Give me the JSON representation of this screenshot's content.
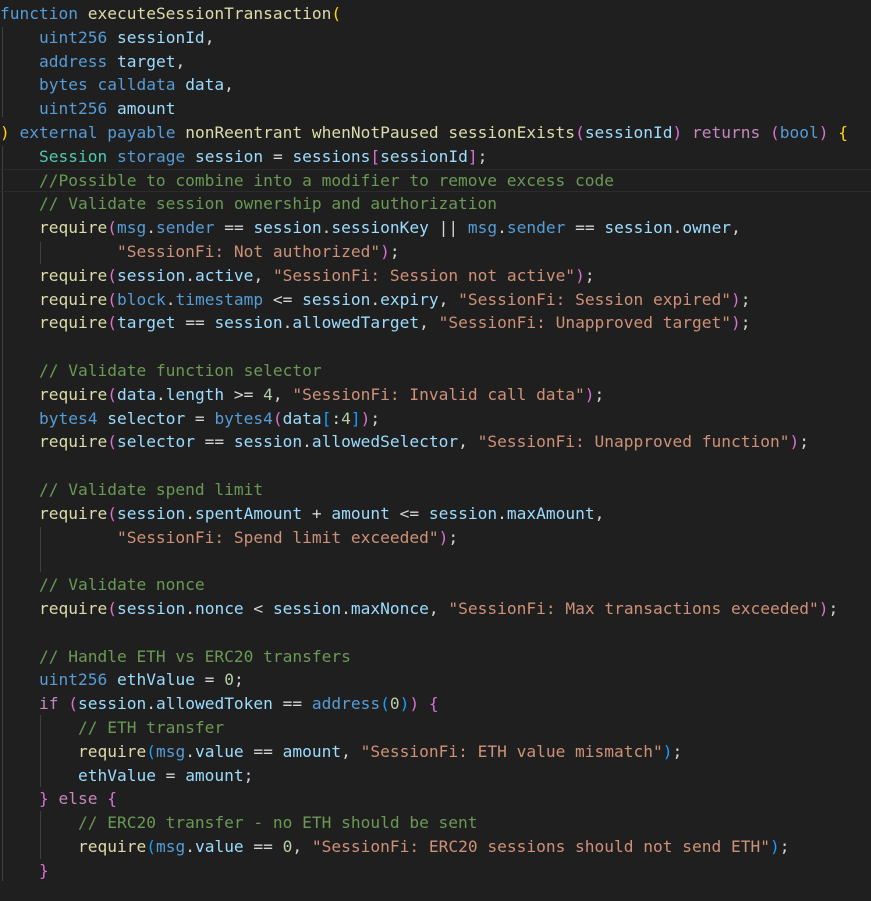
{
  "editor": {
    "language": "solidity",
    "lines": [
      [
        [
          "function",
          "kw"
        ],
        [
          " ",
          ""
        ],
        [
          "executeSessionTransaction",
          "fn"
        ],
        [
          "(",
          "p1"
        ]
      ],
      [
        [
          "    ",
          ""
        ],
        [
          "uint256",
          "kw"
        ],
        [
          " ",
          ""
        ],
        [
          "sessionId",
          "var"
        ],
        [
          ",",
          "op"
        ]
      ],
      [
        [
          "    ",
          ""
        ],
        [
          "address",
          "kw"
        ],
        [
          " ",
          ""
        ],
        [
          "target",
          "var"
        ],
        [
          ",",
          "op"
        ]
      ],
      [
        [
          "    ",
          ""
        ],
        [
          "bytes",
          "kw"
        ],
        [
          " ",
          ""
        ],
        [
          "calldata",
          "kw"
        ],
        [
          " ",
          ""
        ],
        [
          "data",
          "var"
        ],
        [
          ",",
          "op"
        ]
      ],
      [
        [
          "    ",
          ""
        ],
        [
          "uint256",
          "kw"
        ],
        [
          " ",
          ""
        ],
        [
          "amount",
          "var"
        ]
      ],
      [
        [
          ")",
          "p1"
        ],
        [
          " ",
          ""
        ],
        [
          "external",
          "kw"
        ],
        [
          " ",
          ""
        ],
        [
          "payable",
          "kw"
        ],
        [
          " ",
          ""
        ],
        [
          "nonReentrant",
          "fn"
        ],
        [
          " ",
          ""
        ],
        [
          "whenNotPaused",
          "fn"
        ],
        [
          " ",
          ""
        ],
        [
          "sessionExists",
          "fn"
        ],
        [
          "(",
          "p2"
        ],
        [
          "sessionId",
          "var"
        ],
        [
          ")",
          "p2"
        ],
        [
          " ",
          ""
        ],
        [
          "returns",
          "ctl"
        ],
        [
          " ",
          ""
        ],
        [
          "(",
          "p2"
        ],
        [
          "bool",
          "kw"
        ],
        [
          ")",
          "p2"
        ],
        [
          " ",
          ""
        ],
        [
          "{",
          "p1"
        ]
      ],
      [
        [
          "    ",
          ""
        ],
        [
          "Session",
          "ty"
        ],
        [
          " ",
          ""
        ],
        [
          "storage",
          "kw"
        ],
        [
          " ",
          ""
        ],
        [
          "session",
          "var"
        ],
        [
          " ",
          ""
        ],
        [
          "=",
          "op"
        ],
        [
          " ",
          ""
        ],
        [
          "sessions",
          "var"
        ],
        [
          "[",
          "p2"
        ],
        [
          "sessionId",
          "var"
        ],
        [
          "]",
          "p2"
        ],
        [
          ";",
          "op"
        ]
      ],
      [
        [
          "    ",
          ""
        ],
        [
          "//Possible to combine into a modifier to remove excess code",
          "cmt"
        ]
      ],
      [
        [
          "    ",
          ""
        ],
        [
          "// Validate session ownership and authorization",
          "cmt"
        ]
      ],
      [
        [
          "    ",
          ""
        ],
        [
          "require",
          "fn"
        ],
        [
          "(",
          "p2"
        ],
        [
          "msg",
          "kw"
        ],
        [
          ".",
          "op"
        ],
        [
          "sender",
          "kw"
        ],
        [
          " == ",
          "op"
        ],
        [
          "session",
          "var"
        ],
        [
          ".",
          "op"
        ],
        [
          "sessionKey",
          "var"
        ],
        [
          " || ",
          "op"
        ],
        [
          "msg",
          "kw"
        ],
        [
          ".",
          "op"
        ],
        [
          "sender",
          "kw"
        ],
        [
          " == ",
          "op"
        ],
        [
          "session",
          "var"
        ],
        [
          ".",
          "op"
        ],
        [
          "owner",
          "var"
        ],
        [
          ",",
          "op"
        ]
      ],
      [
        [
          "            ",
          ""
        ],
        [
          "\"SessionFi: Not authorized\"",
          "str"
        ],
        [
          ")",
          "p2"
        ],
        [
          ";",
          "op"
        ]
      ],
      [
        [
          "    ",
          ""
        ],
        [
          "require",
          "fn"
        ],
        [
          "(",
          "p2"
        ],
        [
          "session",
          "var"
        ],
        [
          ".",
          "op"
        ],
        [
          "active",
          "var"
        ],
        [
          ", ",
          "op"
        ],
        [
          "\"SessionFi: Session not active\"",
          "str"
        ],
        [
          ")",
          "p2"
        ],
        [
          ";",
          "op"
        ]
      ],
      [
        [
          "    ",
          ""
        ],
        [
          "require",
          "fn"
        ],
        [
          "(",
          "p2"
        ],
        [
          "block",
          "kw"
        ],
        [
          ".",
          "op"
        ],
        [
          "timestamp",
          "kw"
        ],
        [
          " <= ",
          "op"
        ],
        [
          "session",
          "var"
        ],
        [
          ".",
          "op"
        ],
        [
          "expiry",
          "var"
        ],
        [
          ", ",
          "op"
        ],
        [
          "\"SessionFi: Session expired\"",
          "str"
        ],
        [
          ")",
          "p2"
        ],
        [
          ";",
          "op"
        ]
      ],
      [
        [
          "    ",
          ""
        ],
        [
          "require",
          "fn"
        ],
        [
          "(",
          "p2"
        ],
        [
          "target",
          "var"
        ],
        [
          " == ",
          "op"
        ],
        [
          "session",
          "var"
        ],
        [
          ".",
          "op"
        ],
        [
          "allowedTarget",
          "var"
        ],
        [
          ", ",
          "op"
        ],
        [
          "\"SessionFi: Unapproved target\"",
          "str"
        ],
        [
          ")",
          "p2"
        ],
        [
          ";",
          "op"
        ]
      ],
      [],
      [
        [
          "    ",
          ""
        ],
        [
          "// Validate function selector",
          "cmt"
        ]
      ],
      [
        [
          "    ",
          ""
        ],
        [
          "require",
          "fn"
        ],
        [
          "(",
          "p2"
        ],
        [
          "data",
          "var"
        ],
        [
          ".",
          "op"
        ],
        [
          "length",
          "var"
        ],
        [
          " >= ",
          "op"
        ],
        [
          "4",
          "num"
        ],
        [
          ", ",
          "op"
        ],
        [
          "\"SessionFi: Invalid call data\"",
          "str"
        ],
        [
          ")",
          "p2"
        ],
        [
          ";",
          "op"
        ]
      ],
      [
        [
          "    ",
          ""
        ],
        [
          "bytes4",
          "kw"
        ],
        [
          " ",
          ""
        ],
        [
          "selector",
          "var"
        ],
        [
          " = ",
          "op"
        ],
        [
          "bytes4",
          "kw"
        ],
        [
          "(",
          "p2"
        ],
        [
          "data",
          "var"
        ],
        [
          "[",
          "p3"
        ],
        [
          ":",
          "op"
        ],
        [
          "4",
          "num"
        ],
        [
          "]",
          "p3"
        ],
        [
          ")",
          "p2"
        ],
        [
          ";",
          "op"
        ]
      ],
      [
        [
          "    ",
          ""
        ],
        [
          "require",
          "fn"
        ],
        [
          "(",
          "p2"
        ],
        [
          "selector",
          "var"
        ],
        [
          " == ",
          "op"
        ],
        [
          "session",
          "var"
        ],
        [
          ".",
          "op"
        ],
        [
          "allowedSelector",
          "var"
        ],
        [
          ", ",
          "op"
        ],
        [
          "\"SessionFi: Unapproved function\"",
          "str"
        ],
        [
          ")",
          "p2"
        ],
        [
          ";",
          "op"
        ]
      ],
      [],
      [
        [
          "    ",
          ""
        ],
        [
          "// Validate spend limit",
          "cmt"
        ]
      ],
      [
        [
          "    ",
          ""
        ],
        [
          "require",
          "fn"
        ],
        [
          "(",
          "p2"
        ],
        [
          "session",
          "var"
        ],
        [
          ".",
          "op"
        ],
        [
          "spentAmount",
          "var"
        ],
        [
          " + ",
          "op"
        ],
        [
          "amount",
          "var"
        ],
        [
          " <= ",
          "op"
        ],
        [
          "session",
          "var"
        ],
        [
          ".",
          "op"
        ],
        [
          "maxAmount",
          "var"
        ],
        [
          ",",
          "op"
        ]
      ],
      [
        [
          "            ",
          ""
        ],
        [
          "\"SessionFi: Spend limit exceeded\"",
          "str"
        ],
        [
          ")",
          "p2"
        ],
        [
          ";",
          "op"
        ]
      ],
      [],
      [
        [
          "    ",
          ""
        ],
        [
          "// Validate nonce",
          "cmt"
        ]
      ],
      [
        [
          "    ",
          ""
        ],
        [
          "require",
          "fn"
        ],
        [
          "(",
          "p2"
        ],
        [
          "session",
          "var"
        ],
        [
          ".",
          "op"
        ],
        [
          "nonce",
          "var"
        ],
        [
          " < ",
          "op"
        ],
        [
          "session",
          "var"
        ],
        [
          ".",
          "op"
        ],
        [
          "maxNonce",
          "var"
        ],
        [
          ", ",
          "op"
        ],
        [
          "\"SessionFi: Max transactions exceeded\"",
          "str"
        ],
        [
          ")",
          "p2"
        ],
        [
          ";",
          "op"
        ]
      ],
      [],
      [
        [
          "    ",
          ""
        ],
        [
          "// Handle ETH vs ERC20 transfers",
          "cmt"
        ]
      ],
      [
        [
          "    ",
          ""
        ],
        [
          "uint256",
          "kw"
        ],
        [
          " ",
          ""
        ],
        [
          "ethValue",
          "var"
        ],
        [
          " = ",
          "op"
        ],
        [
          "0",
          "num"
        ],
        [
          ";",
          "op"
        ]
      ],
      [
        [
          "    ",
          ""
        ],
        [
          "if",
          "ctl"
        ],
        [
          " ",
          ""
        ],
        [
          "(",
          "p2"
        ],
        [
          "session",
          "var"
        ],
        [
          ".",
          "op"
        ],
        [
          "allowedToken",
          "var"
        ],
        [
          " == ",
          "op"
        ],
        [
          "address",
          "kw"
        ],
        [
          "(",
          "p3"
        ],
        [
          "0",
          "num"
        ],
        [
          ")",
          "p3"
        ],
        [
          ")",
          "p2"
        ],
        [
          " ",
          ""
        ],
        [
          "{",
          "p2"
        ]
      ],
      [
        [
          "        ",
          ""
        ],
        [
          "// ETH transfer",
          "cmt"
        ]
      ],
      [
        [
          "        ",
          ""
        ],
        [
          "require",
          "fn"
        ],
        [
          "(",
          "p3"
        ],
        [
          "msg",
          "kw"
        ],
        [
          ".",
          "op"
        ],
        [
          "value",
          "var"
        ],
        [
          " == ",
          "op"
        ],
        [
          "amount",
          "var"
        ],
        [
          ", ",
          "op"
        ],
        [
          "\"SessionFi: ETH value mismatch\"",
          "str"
        ],
        [
          ")",
          "p3"
        ],
        [
          ";",
          "op"
        ]
      ],
      [
        [
          "        ",
          ""
        ],
        [
          "ethValue",
          "var"
        ],
        [
          " = ",
          "op"
        ],
        [
          "amount",
          "var"
        ],
        [
          ";",
          "op"
        ]
      ],
      [
        [
          "    ",
          ""
        ],
        [
          "}",
          "p2"
        ],
        [
          " ",
          ""
        ],
        [
          "else",
          "ctl"
        ],
        [
          " ",
          ""
        ],
        [
          "{",
          "p2"
        ]
      ],
      [
        [
          "        ",
          ""
        ],
        [
          "// ERC20 transfer - no ETH should be sent",
          "cmt"
        ]
      ],
      [
        [
          "        ",
          ""
        ],
        [
          "require",
          "fn"
        ],
        [
          "(",
          "p3"
        ],
        [
          "msg",
          "kw"
        ],
        [
          ".",
          "op"
        ],
        [
          "value",
          "var"
        ],
        [
          " == ",
          "op"
        ],
        [
          "0",
          "num"
        ],
        [
          ", ",
          "op"
        ],
        [
          "\"SessionFi: ERC20 sessions should not send ETH\"",
          "str"
        ],
        [
          ")",
          "p3"
        ],
        [
          ";",
          "op"
        ]
      ],
      [
        [
          "    ",
          ""
        ],
        [
          "}",
          "p2"
        ]
      ]
    ]
  }
}
